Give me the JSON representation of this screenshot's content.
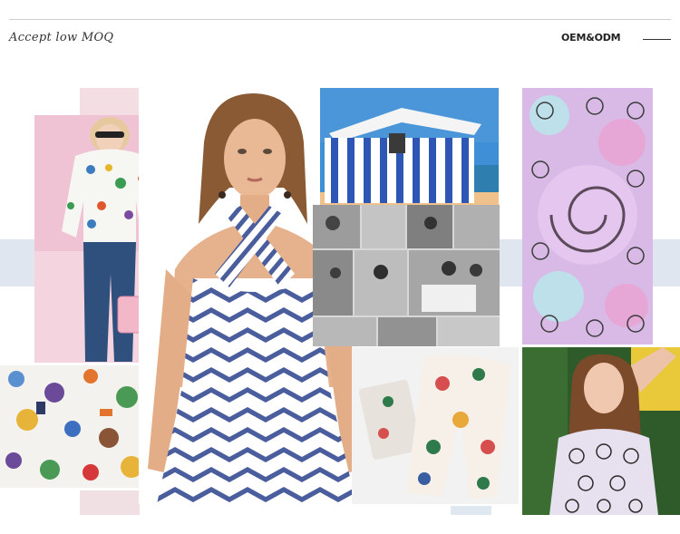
{
  "header": {
    "tagline": "Accept low MOQ",
    "service": "OEM&ODM"
  },
  "icons": [
    "menu-dash-icon"
  ],
  "colors": {
    "band": "#dfe6ef",
    "accent_pink": "#f3dfe3",
    "stripe_blue": "#4a5d9c"
  }
}
